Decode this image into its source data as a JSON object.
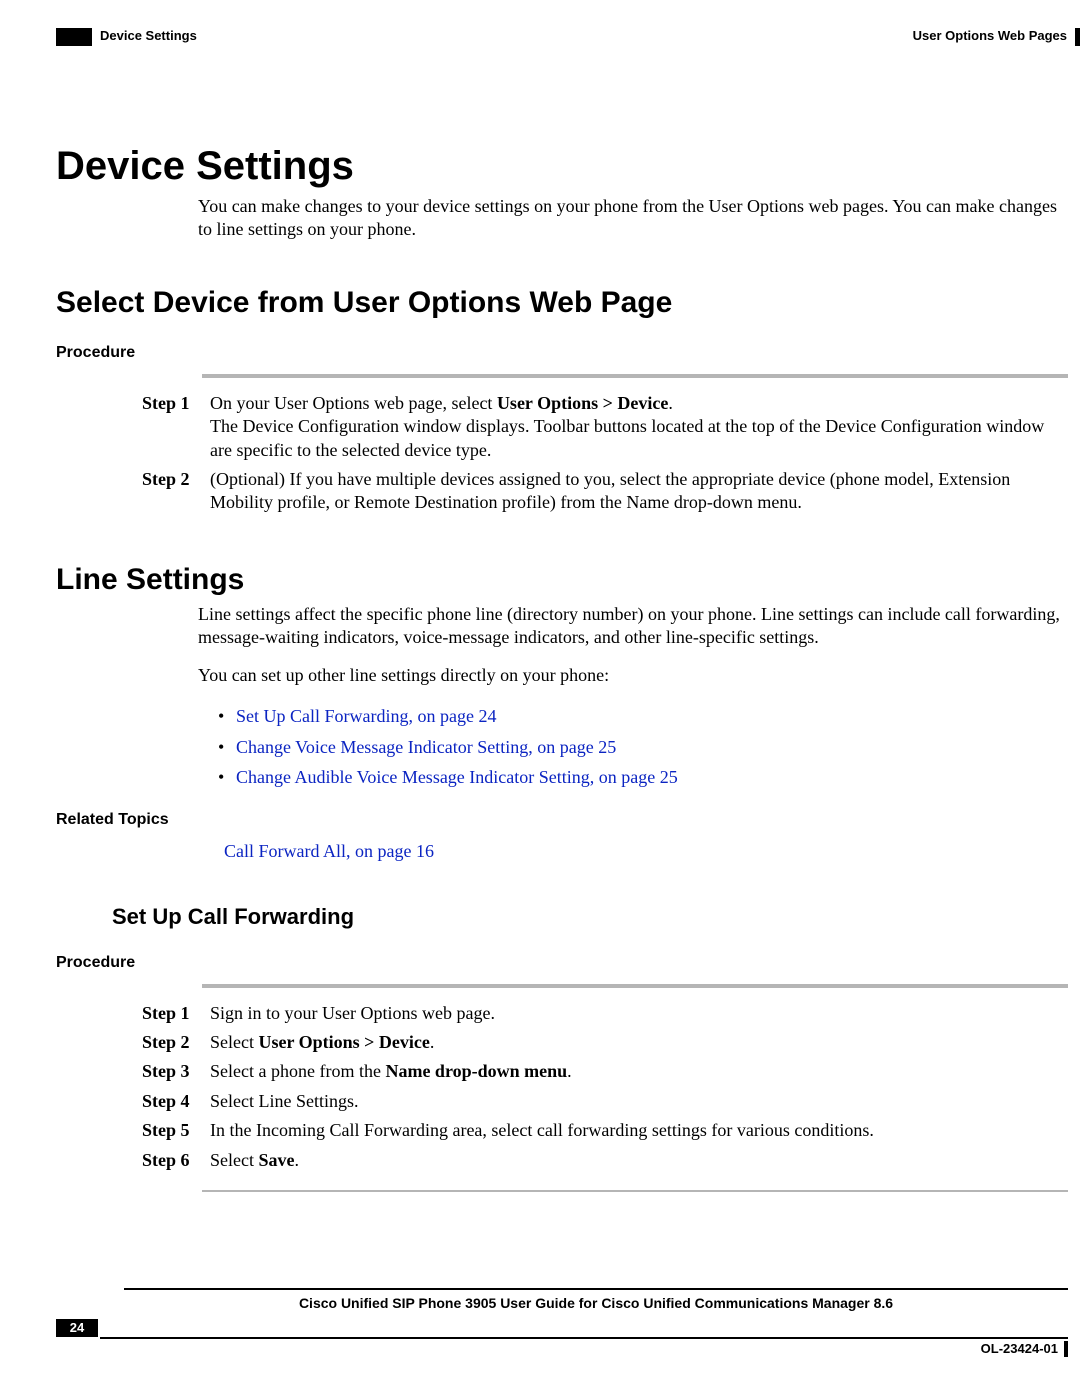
{
  "header": {
    "left": "Device Settings",
    "right": "User Options Web Pages"
  },
  "h1": "Device Settings",
  "intro": "You can make changes to your device settings on your phone from the User Options web pages. You can make changes to line settings on your phone.",
  "selectDevice": {
    "heading": "Select Device from User Options Web Page",
    "procedureLabel": "Procedure",
    "steps": [
      {
        "label": "Step 1",
        "text_pre": "On your User Options web page, select ",
        "bold": "User Options > Device",
        "text_post": ".",
        "extra": "The Device Configuration window displays. Toolbar buttons located at the top of the Device Configuration window are specific to the selected device type."
      },
      {
        "label": "Step 2",
        "text_pre": "(Optional) If you have multiple devices assigned to you, select the appropriate device (phone model, Extension Mobility profile, or Remote Destination profile) from the Name drop-down menu.",
        "bold": "",
        "text_post": "",
        "extra": ""
      }
    ]
  },
  "lineSettings": {
    "heading": "Line Settings",
    "para1": "Line settings affect the specific phone line (directory number) on your phone. Line settings can include call forwarding, message-waiting indicators, voice-message indicators, and other line-specific settings.",
    "para2": "You can set up other line settings directly on your phone:",
    "bullets": [
      "Set Up Call Forwarding,  on page 24",
      "Change Voice Message Indicator Setting,  on page 25",
      "Change Audible Voice Message Indicator Setting,  on page 25"
    ],
    "relatedLabel": "Related Topics",
    "relatedLink": "Call Forward All,  on page 16"
  },
  "setupCF": {
    "heading": "Set Up Call Forwarding",
    "procedureLabel": "Procedure",
    "steps": [
      {
        "label": "Step 1",
        "pre": "Sign in to your User Options web page.",
        "bold": "",
        "post": ""
      },
      {
        "label": "Step 2",
        "pre": "Select ",
        "bold": "User Options > Device",
        "post": "."
      },
      {
        "label": "Step 3",
        "pre": "Select a phone from the ",
        "bold": "Name drop-down menu",
        "post": "."
      },
      {
        "label": "Step 4",
        "pre": "Select Line Settings.",
        "bold": "",
        "post": ""
      },
      {
        "label": "Step 5",
        "pre": "In the Incoming Call Forwarding area, select call forwarding settings for various conditions.",
        "bold": "",
        "post": ""
      },
      {
        "label": "Step 6",
        "pre": "Select ",
        "bold": "Save",
        "post": "."
      }
    ]
  },
  "footer": {
    "title": "Cisco Unified SIP Phone 3905 User Guide for Cisco Unified Communications Manager 8.6",
    "page": "24",
    "docid": "OL-23424-01"
  }
}
